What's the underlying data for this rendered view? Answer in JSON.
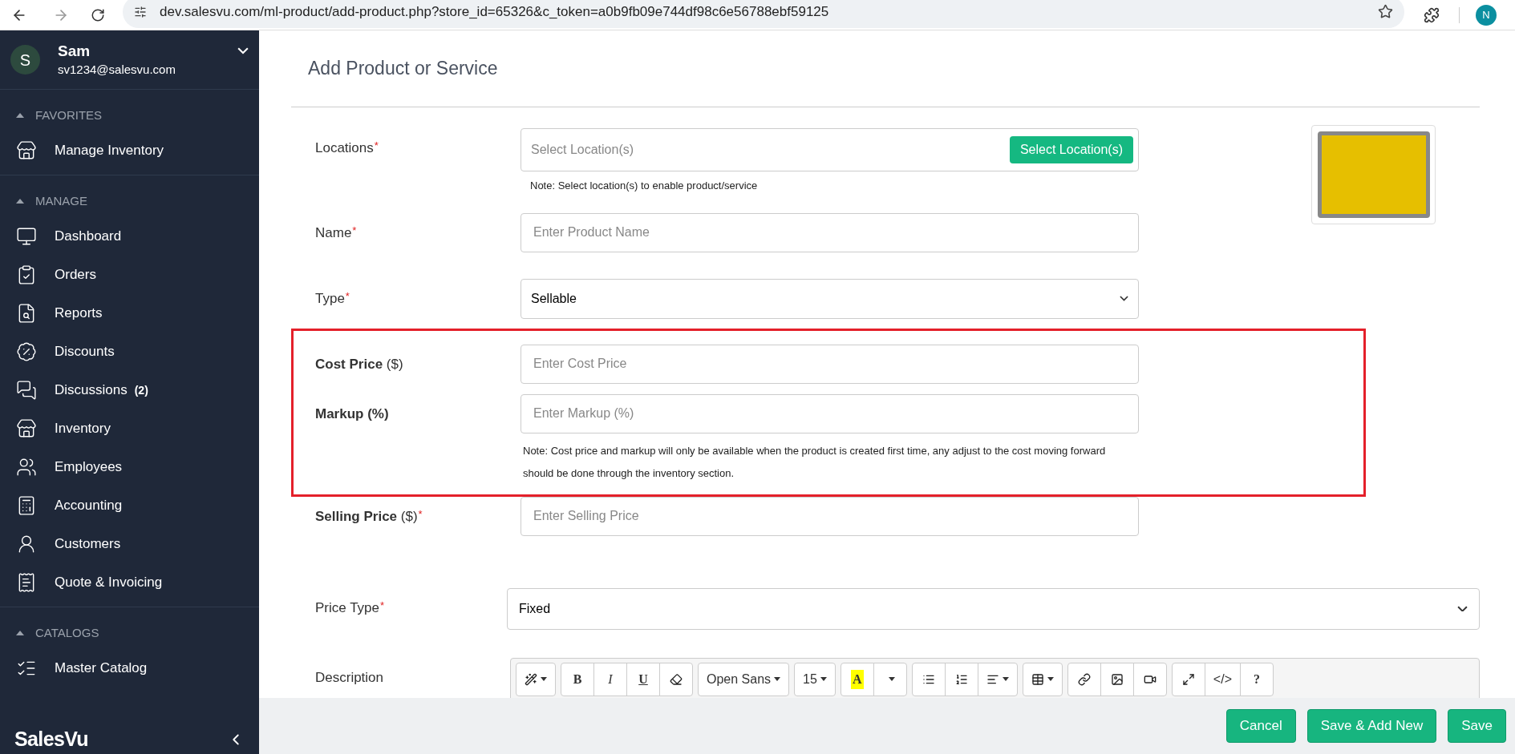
{
  "browser": {
    "url": "dev.salesvu.com/ml-product/add-product.php?store_id=65326&c_token=a0b9fb09e744df98c6e56788ebf59125",
    "profile_initial": "N"
  },
  "user": {
    "initial": "S",
    "name": "Sam",
    "email": "sv1234@salesvu.com"
  },
  "sidebar": {
    "sections": [
      {
        "title": "FAVORITES",
        "expanded": true,
        "items": [
          {
            "label": "Manage Inventory"
          }
        ]
      },
      {
        "title": "MANAGE",
        "expanded": true,
        "items": [
          {
            "label": "Dashboard"
          },
          {
            "label": "Orders"
          },
          {
            "label": "Reports"
          },
          {
            "label": "Discounts"
          },
          {
            "label": "Discussions",
            "count": "(2)"
          },
          {
            "label": "Inventory"
          },
          {
            "label": "Employees"
          },
          {
            "label": "Accounting"
          },
          {
            "label": "Customers"
          },
          {
            "label": "Quote & Invoicing"
          }
        ]
      },
      {
        "title": "CATALOGS",
        "expanded": true,
        "items": [
          {
            "label": "Master Catalog"
          }
        ]
      }
    ]
  },
  "brand": "SalesVu",
  "form": {
    "title": "Add Product or Service",
    "fields": [
      {
        "kind": "location",
        "label": "Locations",
        "required_mark": "*",
        "placeholder": "Select Location(s)",
        "button": "Select Location(s)",
        "note": "Note: Select location(s) to enable product/service"
      },
      {
        "kind": "text",
        "label": "Name",
        "required_mark": "*",
        "placeholder": "Enter Product Name"
      },
      {
        "kind": "select",
        "label": "Type",
        "required_mark": "*",
        "value": "Sellable"
      }
    ],
    "highlight_box": {
      "fields": [
        {
          "kind": "text",
          "label": "**Cost Price** ($)",
          "placeholder": "Enter Cost Price"
        },
        {
          "kind": "text",
          "label": "**Markup (%)**",
          "placeholder": "Enter Markup (%)",
          "note": "Note: Cost price and markup will only be available when the product is created first time, any adjust to the cost moving forward should be done through the inventory section."
        }
      ]
    },
    "more_fields": [
      {
        "kind": "text",
        "label": "**Selling Price** ($)",
        "required_mark": "*",
        "placeholder": "Enter Selling Price"
      },
      {
        "kind": "wide_select",
        "label": "Price Type",
        "required_mark": "*",
        "value": "Fixed"
      },
      {
        "kind": "editor",
        "label": "Description",
        "toolbar": [
          [
            {
              "kind": "icon",
              "dropdown": true
            }
          ],
          [
            {
              "kind": "bold",
              "text": "B"
            },
            {
              "kind": "italic",
              "text": "I"
            },
            {
              "kind": "underline",
              "text": "U"
            },
            {
              "kind": "icon",
              "dropdown": false
            }
          ],
          [
            {
              "kind": "plain",
              "text": "Open Sans",
              "dropdown": true
            }
          ],
          [
            {
              "kind": "plain",
              "text": "15",
              "dropdown": true
            }
          ],
          [
            {
              "kind": "highlight",
              "text": "A",
              "dropdown": false
            },
            {
              "kind": "caret"
            }
          ],
          [
            {
              "kind": "icon",
              "dropdown": false
            },
            {
              "kind": "icon",
              "dropdown": false
            },
            {
              "kind": "icon",
              "dropdown": true
            }
          ],
          [
            {
              "kind": "icon",
              "dropdown": true
            }
          ],
          [
            {
              "kind": "icon",
              "dropdown": false
            },
            {
              "kind": "icon",
              "dropdown": false
            },
            {
              "kind": "icon",
              "dropdown": false
            }
          ],
          [
            {
              "kind": "icon",
              "dropdown": false
            },
            {
              "kind": "plain",
              "text": "</>",
              "dropdown": false
            },
            {
              "kind": "bold",
              "text": "?"
            }
          ]
        ]
      }
    ]
  },
  "footer_buttons": [
    "Cancel",
    "Save & Add New",
    "Save"
  ]
}
